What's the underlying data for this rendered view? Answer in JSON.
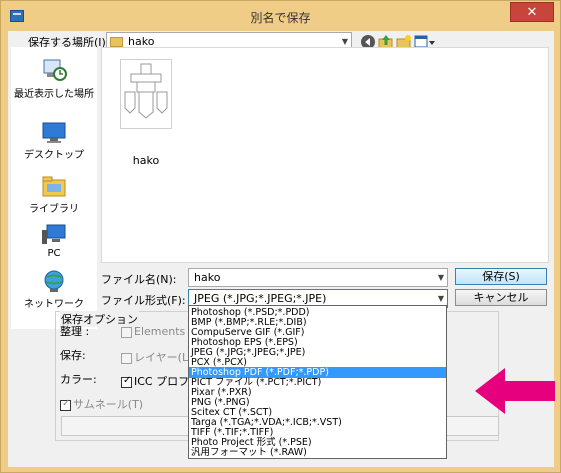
{
  "window": {
    "title": "別名で保存",
    "close_label": "✕"
  },
  "location": {
    "label": "保存する場所(I):",
    "value": "hako"
  },
  "places": [
    {
      "label": "最近表示した場所",
      "icon": "recent-places-icon"
    },
    {
      "label": "デスクトップ",
      "icon": "desktop-icon"
    },
    {
      "label": "ライブラリ",
      "icon": "libraries-icon"
    },
    {
      "label": "PC",
      "icon": "pc-icon"
    },
    {
      "label": "ネットワーク",
      "icon": "network-icon"
    }
  ],
  "files": [
    {
      "name": "hako",
      "icon": "psd-thumbnail-icon"
    }
  ],
  "filename": {
    "label": "ファイル名(N):",
    "value": "hako"
  },
  "filetype": {
    "label": "ファイル形式(F):",
    "value": "JPEG (*.JPG;*.JPEG;*.JPE)"
  },
  "buttons": {
    "save": "保存(S)",
    "cancel": "キャンセル"
  },
  "options": {
    "header": "保存オプション",
    "organize_label": "整理 :",
    "elements_label": "Elements Org",
    "save_label": "保存:",
    "layers_label": "レイヤー(L)",
    "color_label": "カラー:",
    "icc_label": "ICC プロファイル",
    "thumbnail_label": "サムネール(T)"
  },
  "filetype_options": [
    "Photoshop (*.PSD;*.PDD)",
    "BMP (*.BMP;*.RLE;*.DIB)",
    "CompuServe GIF (*.GIF)",
    "Photoshop EPS (*.EPS)",
    "JPEG (*.JPG;*.JPEG;*.JPE)",
    "PCX (*.PCX)",
    "Photoshop PDF (*.PDF;*.PDP)",
    "PICT ファイル (*.PCT;*.PICT)",
    "Pixar (*.PXR)",
    "PNG (*.PNG)",
    "Scitex CT (*.SCT)",
    "Targa (*.TGA;*.VDA;*.ICB;*.VST)",
    "TIFF (*.TIF;*.TIFF)",
    "Photo Project 形式 (*.PSE)",
    "汎用フォーマット (*.RAW)"
  ],
  "selected_option_index": 6,
  "colors": {
    "accent_arrow": "#e6007e",
    "selection": "#3399ff",
    "title_bar": "#f0cd86"
  }
}
